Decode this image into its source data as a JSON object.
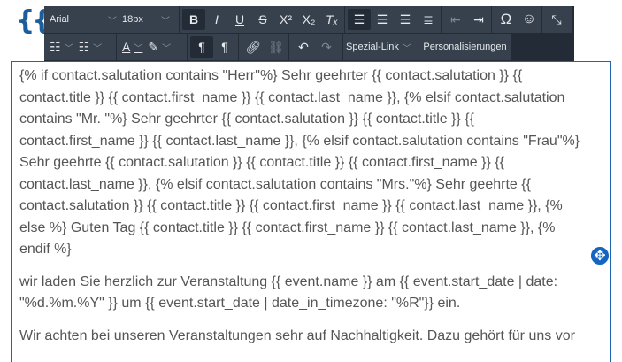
{
  "logo": "{{",
  "toolbar": {
    "font": "Arial",
    "size": "18px",
    "format": [
      {
        "n": "bold",
        "g": "B"
      },
      {
        "n": "italic",
        "g": "I"
      },
      {
        "n": "underline",
        "g": "U"
      },
      {
        "n": "strikethrough",
        "g": "S"
      },
      {
        "n": "superscript",
        "g": "X²"
      },
      {
        "n": "subscript",
        "g": "X₂"
      },
      {
        "n": "clear-format",
        "g": "Tₓ"
      }
    ],
    "spezial_link": "Spezial-Link",
    "personalisierungen": "Personalisierungen"
  },
  "editor": {
    "p1": [
      "{% if contact.salutation contains \"Herr\"%} Sehr geehrter {{ contact.salutation }} {{",
      "contact.title }} {{ contact.first_name }} {{ contact.last_name }}, {% elsif contact.salutation",
      "contains \"Mr. \"%} Sehr geehrter {{ contact.salutation }} {{ contact.title }} {{",
      "contact.first_name }} {{ contact.last_name }}, {% elsif contact.salutation contains \"Frau\"%}",
      "Sehr geehrte {{ contact.salutation }} {{ contact.title }} {{ contact.first_name }} {{",
      "contact.last_name }}, {% elsif contact.salutation contains \"Mrs.\"%} Sehr geehrte {{",
      "contact.salutation }} {{ contact.title }} {{ contact.first_name }} {{ contact.last_name }}, {%",
      "else %} Guten Tag {{ contact.title }} {{ contact.first_name }} {{ contact.last_name }}, {%",
      "endif %}"
    ],
    "p2": [
      "wir laden Sie herzlich zur Veranstaltung {{ event.name }} am {{ event.start_date | date:",
      "\"%d.%m.%Y\" }} um {{ event.start_date | date_in_timezone: \"%R\"}} ein."
    ],
    "p3": [
      "Wir achten bei unseren Veranstaltungen sehr auf Nachhaltigkeit. Dazu gehört für uns vor"
    ]
  }
}
